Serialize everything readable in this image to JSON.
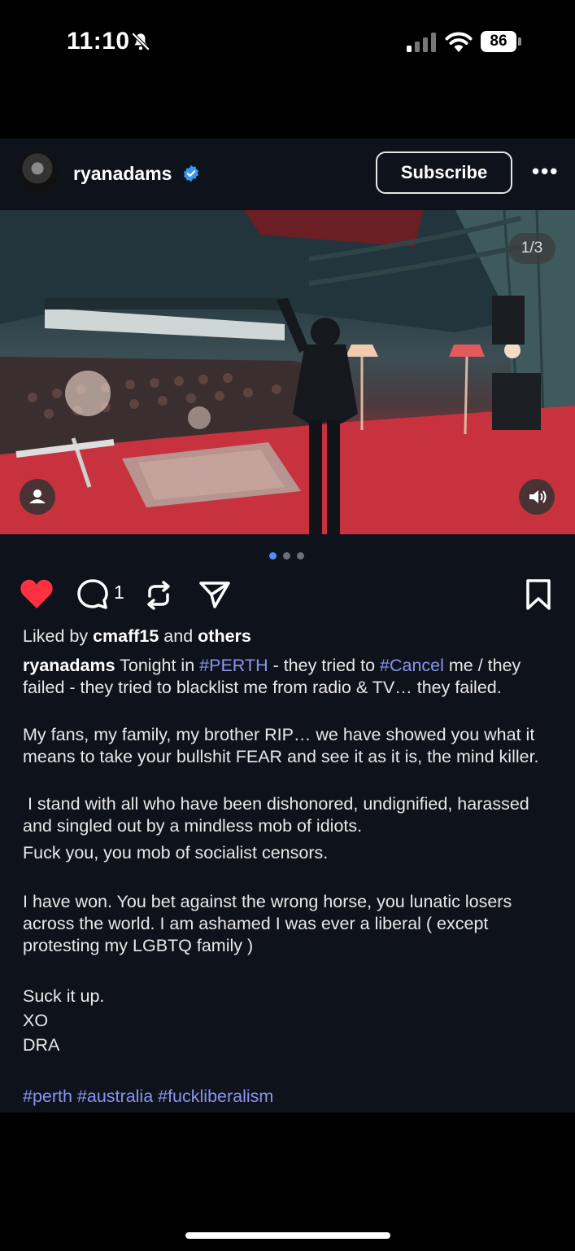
{
  "status_bar": {
    "time": "11:10",
    "battery": "86",
    "icons": [
      "bell-slash-icon",
      "cellular-signal-icon",
      "wifi-icon",
      "battery-icon"
    ]
  },
  "post": {
    "username": "ryanadams",
    "subscribe_label": "Subscribe",
    "more_label": "•••",
    "media_counter": "1/3",
    "carousel": {
      "count": 3,
      "active": 0
    },
    "comment_count": "1",
    "liked_by": {
      "prefix": "Liked by ",
      "user": "cmaff15",
      "middle": " and ",
      "others": "others"
    },
    "caption": {
      "author": "ryanadams",
      "p1_a": " Tonight in ",
      "tag_perth": "#PERTH",
      "p1_b": " - they tried to ",
      "tag_cancel": "#Cancel",
      "p1_c": " me / they failed - they tried to blacklist me from radio & TV… they failed.",
      "p2": "My fans, my family, my brother RIP… we have showed you what it means to take your bullshit FEAR and see it as it is, the mind killer.",
      "p3": " I stand with all who have been dishonored, undignified, harassed and singled out by a mindless mob of idiots.",
      "p4": "Fuck you, you mob of socialist censors.",
      "p5": "I have won. You bet against the wrong horse, you lunatic losers across the world. I am ashamed I was ever a liberal ( except protesting my LGBTQ family )",
      "p6": "Suck it up.",
      "p7": "XO",
      "p8": "DRA",
      "hashtags": "#perth #australia #fuckliberalism"
    }
  },
  "colors": {
    "post_bg": "#0e121a",
    "heart": "#ff3040",
    "verified": "#3897f0",
    "hashtag": "#8a94f0",
    "dot_active": "#4f8ef7"
  }
}
